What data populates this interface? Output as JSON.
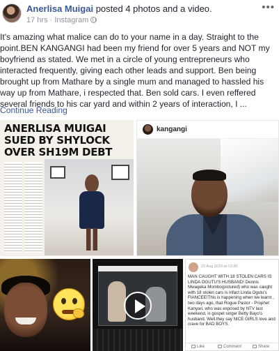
{
  "post": {
    "author": "Anerlisa Muigai",
    "action": " posted 4 photos and a video.",
    "time": "17 hrs",
    "separator": " · ",
    "source": "Instagram",
    "more": "•••",
    "text": "It's amazing what malice can do to your name in a day. Straight to the point.BEN KANGANGI had been my friend for over 5 years and NOT my boyfriend as stated. We met in a circle of young entrepreneurs who interacted frequently, giving each other leads and support. Ben being brought up from Mathare by a single mum and managed to hassled his way up from Mathare, i respected that. Ben sold cars. I even reffered several friends to his car yard and within 2 years of interaction, I ...",
    "continue": "Continue Reading"
  },
  "photos": {
    "newspaper_headline": "ANERLISA MUIGAI SUED BY SHYLOCK OVER SH19M DEBT",
    "instagram_username": "kangangi",
    "screenshot": {
      "date": "22 Aug 2019 at 13:30",
      "text": "MAN CAUGHT WITH 18 STOLEN CARS IS LINDA OGUTU'S HUSBAND! Dennis Mwageka Mombo(pictured) who was caught with 18 stolen cars is infact Linda Ogutu's FIANCEE!This is happening when we learnt , two days ago, that Rogue Pastor - Prophet Kanyari, who was exposed by NTV last weekend, is gospel singer Betty Bayo's husband. Well,they say NICE GIRLS love and crave for BAD BOYS.",
      "like": "Like",
      "comment": "Comment",
      "share": "Share"
    }
  },
  "icons": {
    "more": "more-horizontal-icon",
    "privacy": "globe-icon",
    "video": "play-icon"
  },
  "colors": {
    "author": "#385898",
    "link": "#385898",
    "meta": "#90949c"
  }
}
